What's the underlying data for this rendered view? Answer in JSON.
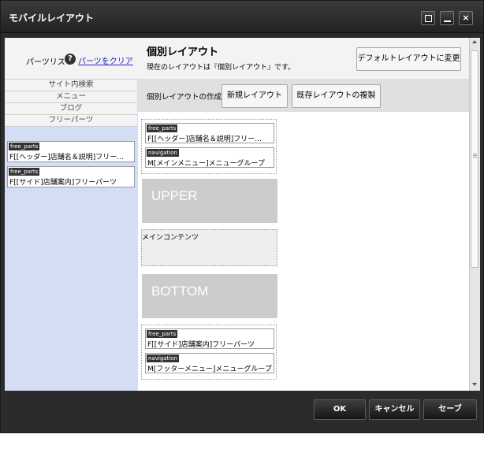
{
  "window": {
    "title": "モバイルレイアウト",
    "close_label": "×"
  },
  "left": {
    "header_label": "パーツリスト",
    "help_icon_label": "?",
    "clear_link": "パーツをクリア",
    "categories": [
      "サイト内検索",
      "メニュー",
      "ブログ",
      "フリーパーツ"
    ],
    "parts": [
      {
        "tag": "free_parts",
        "text": "F[[ヘッダー]店舗名＆説明]フリー..."
      },
      {
        "tag": "free_parts",
        "text": "F[[サイド]店舗案内]フリーパーツ"
      }
    ]
  },
  "right": {
    "title": "個別レイアウト",
    "subtitle": "現在のレイアウトは『個別レイアウト』です。",
    "default_button": "デフォルトレイアウトに変更",
    "create_label": "個別レイアウトの作成",
    "new_button": "新規レイアウト",
    "copy_button": "既存レイアウトの複製",
    "top_parts": [
      {
        "tag": "free_parts",
        "text": "F[[ヘッダー]店舗名＆説明]フリー..."
      },
      {
        "tag": "navigation",
        "text": "M[メインメニュー]メニューグループ"
      }
    ],
    "upper_label": "UPPER",
    "main_label": "メインコンテンツ",
    "bottom_label": "BOTTOM",
    "bottom_parts": [
      {
        "tag": "free_parts",
        "text": "F[[サイド]店舗案内]フリーパーツ"
      },
      {
        "tag": "navigation",
        "text": "M[フッターメニュー]メニューグループ"
      }
    ]
  },
  "footer": {
    "ok": "OK",
    "cancel": "キャンセル",
    "save": "セーブ"
  }
}
